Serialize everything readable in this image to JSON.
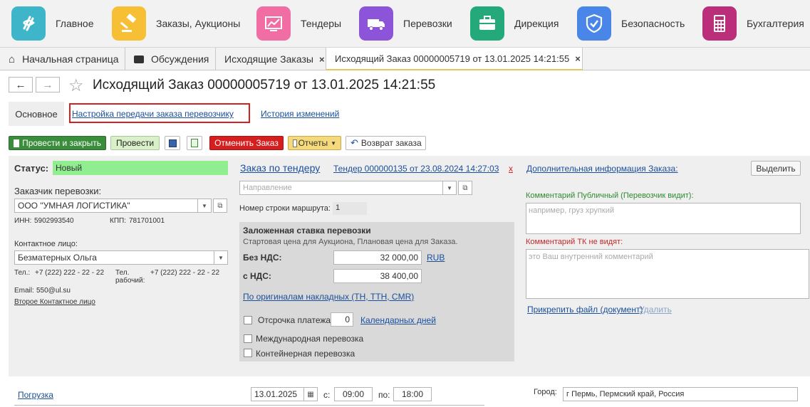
{
  "top_nav": [
    {
      "label": "Главное",
      "icon": "dollar-swirl-icon",
      "color": "#3fb5c9"
    },
    {
      "label": "Заказы, Аукционы",
      "icon": "gavel-icon",
      "color": "#f7c034"
    },
    {
      "label": "Тендеры",
      "icon": "chart-line-icon",
      "color": "#f06ea3"
    },
    {
      "label": "Перевозки",
      "icon": "truck-icon",
      "color": "#8c55d9"
    },
    {
      "label": "Дирекция",
      "icon": "briefcase-icon",
      "color": "#23a97a"
    },
    {
      "label": "Безопасность",
      "icon": "shield-check-icon",
      "color": "#4a86e8"
    },
    {
      "label": "Бухгалтерия",
      "icon": "calculator-icon",
      "color": "#bb2e7a"
    }
  ],
  "tabs": [
    {
      "label": "Начальная страница",
      "icon": "home-icon"
    },
    {
      "label": "Обсуждения",
      "icon": "chat-icon"
    },
    {
      "label": "Исходящие Заказы",
      "close": "×"
    },
    {
      "label": "Исходящий Заказ 00000005719 от 13.01.2025 14:21:55",
      "close": "×"
    }
  ],
  "header": {
    "back": "←",
    "forward": "→",
    "star": "☆",
    "title": "Исходящий Заказ 00000005719 от 13.01.2025 14:21:55"
  },
  "form_tabs": {
    "main": "Основное",
    "carrier_settings": "Настройка передачи заказа перевозчику",
    "history": "История изменений"
  },
  "toolbar": {
    "post_close": "Провести и закрыть",
    "post": "Провести",
    "cancel_order": "Отменить Заказ",
    "reports": "Отчеты",
    "return_order": "Возврат заказа"
  },
  "left": {
    "status_label": "Статус:",
    "status_value": "Новый",
    "customer_label": "Заказчик перевозки:",
    "customer_value": "ООО \"УМНАЯ ЛОГИСТИКА\"",
    "inn_label": "ИНН:",
    "inn_value": "5902993540",
    "kpp_label": "КПП:",
    "kpp_value": "781701001",
    "contact_label": "Контактное лицо:",
    "contact_value": "Безматерных Ольга",
    "phone_label": "Тел.:",
    "phone_value": "+7 (222) 222 - 22 - 22",
    "work_phone_label_1": "Тел.",
    "work_phone_label_2": "рабочий:",
    "work_phone_value": "+7 (222) 222 - 22 - 22",
    "email_label": "Email:",
    "email_value": "550@ul.su",
    "second_contact": "Второе Контактное лицо"
  },
  "middle": {
    "tender_order": "Заказ по тендеру",
    "tender_link": "Тендер 000000135 от 23.08.2024 14:27:03",
    "tender_clear": "x",
    "direction_placeholder": "Направление",
    "route_row_label": "Номер строки маршрута:",
    "route_row_value": "1",
    "rate_title": "Заложенная ставка перевозки",
    "rate_subtitle": "Стартовая цена для Аукциона, Плановая цена для Заказа.",
    "no_vat_label": "Без НДС:",
    "no_vat_value": "32 000,00",
    "currency": "RUB",
    "vat_label": "с НДС:",
    "vat_value": "38 400,00",
    "originals_link": "По оригиналам накладных (ТН, ТТН, CMR)",
    "deferral_label": "Отсрочка платежа:",
    "deferral_value": "0",
    "calendar_days": "Календарных дней",
    "international": "Международная перевозка",
    "container": "Контейнерная перевозка"
  },
  "right": {
    "additional_info": "Дополнительная информация Заказа:",
    "highlight": "Выделить",
    "public_comment_label": "Комментарий Публичный (Перевозчик видит):",
    "public_comment_placeholder": "например, груз хрупкий",
    "private_comment_label": "Комментарий ТК не видят:",
    "private_comment_placeholder": "это Ваш внутренний комментарий",
    "attach_file": "Прикрепить файл (документ)",
    "delete": "Удалить"
  },
  "bottom": {
    "loading": "Погрузка",
    "date": "13.01.2025",
    "from_label": "с:",
    "from_value": "09:00",
    "to_label": "по:",
    "to_value": "18:00",
    "city_label": "Город:",
    "city_value": "г Пермь, Пермский край, Россия"
  },
  "colors": {
    "status_bg": "#90ee90",
    "highlight_border": "#d32222",
    "link": "#1a4f9c",
    "green_label": "#2f8a2f",
    "red_label": "#c62828"
  }
}
